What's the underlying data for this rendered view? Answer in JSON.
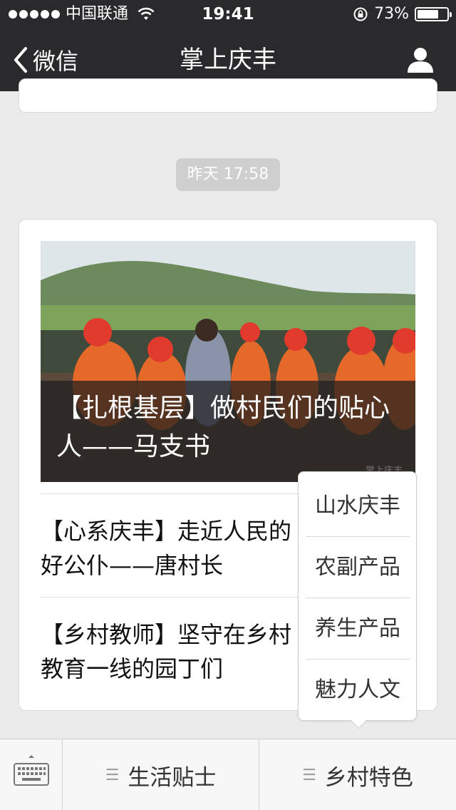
{
  "status_bar": {
    "carrier": "中国联通",
    "time": "19:41",
    "battery": "73%",
    "battery_level": 0.73
  },
  "nav": {
    "back_label": "微信",
    "title": "掌上庆丰"
  },
  "chat": {
    "timestamp": "昨天 17:58"
  },
  "article": {
    "cover_title": "【扎根基层】做村民们的贴心人——马支书",
    "watermark": "掌上庆丰",
    "sub_items": [
      {
        "title": "【心系庆丰】走近人民的好公仆——唐村长"
      },
      {
        "title": "【乡村教师】坚守在乡村教育一线的园丁们"
      }
    ]
  },
  "popup_menu": {
    "items": [
      "山水庆丰",
      "农副产品",
      "养生产品",
      "魅力人文"
    ]
  },
  "bottom_menu": {
    "tabs": [
      {
        "label": "生活贴士"
      },
      {
        "label": "乡村特色"
      }
    ]
  },
  "colors": {
    "nav_bg": "#2a2a2d",
    "page_bg": "#ebebeb",
    "cover_overlay": "#1e1e1e"
  }
}
